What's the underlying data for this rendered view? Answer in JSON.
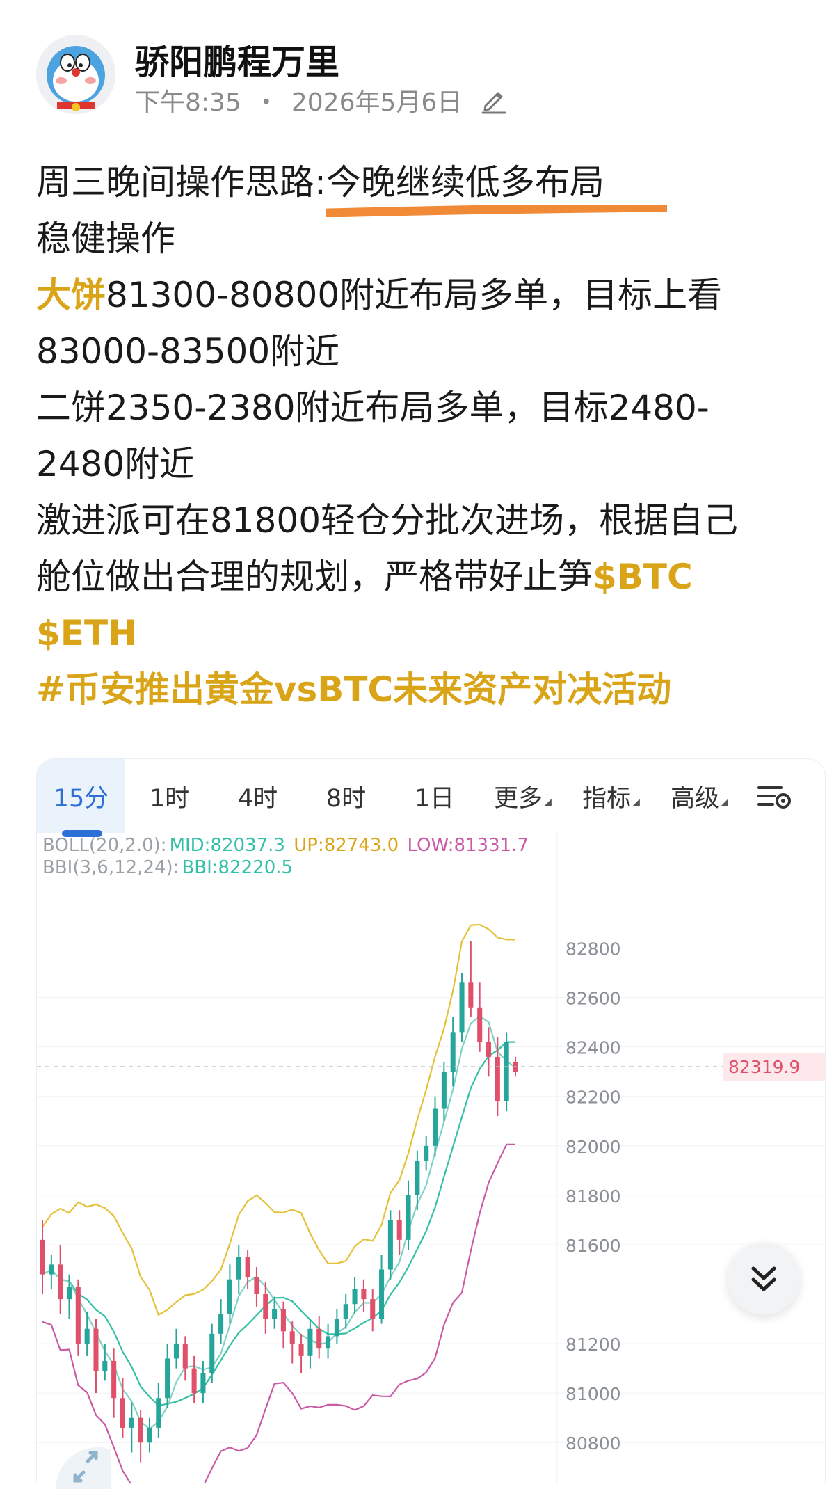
{
  "post": {
    "author": "骄阳鹏程万里",
    "time": "下午8:35",
    "separator": "・",
    "date": "2026年5月6日",
    "line1_prefix": "周三晚间操作思路:",
    "line1_underlined": "今晚继续低多布局",
    "line2": "稳健操作",
    "line3_label": "大饼",
    "line3_rest": "81300-80800附近布局多单，目标上看",
    "line4": "83000-83500附近",
    "line5": "二饼2350-2380附近布局多单，目标2480-",
    "line6": "2480附近",
    "line7": "激进派可在81800轻仓分批次进场，根据自己",
    "line8": "舱位做出合理的规划，严格带好止笋",
    "tag_btc": "$BTC",
    "tag_eth": "$ETH",
    "hashtag": "#币安推出黄金vsBTC未来资产对决活动"
  },
  "kline": {
    "tabs": [
      {
        "label": "15分",
        "active": true
      },
      {
        "label": "1时"
      },
      {
        "label": "4时"
      },
      {
        "label": "8时"
      },
      {
        "label": "1日"
      },
      {
        "label": "更多",
        "caret": true
      },
      {
        "label": "指标",
        "caret": true
      },
      {
        "label": "高级",
        "caret": true
      }
    ],
    "settings_icon": "chart-settings-icon",
    "boll_label": "BOLL(20,2.0):",
    "boll_mid": "MID:82037.3",
    "boll_up": "UP:82743.0",
    "boll_low": "LOW:81331.7",
    "bbi_label": "BBI(3,6,12,24):",
    "bbi_value": "BBI:82220.5",
    "high_marker": "82828.7",
    "last_price": "82319.9",
    "colors": {
      "up": "#26a69a",
      "down": "#e0506a",
      "mid": "#33c0a6",
      "upper": "#e3c23a",
      "lower": "#c95aa5",
      "price": "#e0506a"
    }
  },
  "chart_data": {
    "type": "candlestick",
    "y_axis_labels": [
      "82800",
      "82600",
      "82400",
      "82200",
      "82000",
      "81800",
      "81600",
      "81200",
      "81000",
      "80800"
    ],
    "ylim": [
      80750,
      82900
    ],
    "high": 82828.7,
    "last": 82319.9,
    "candles": [
      [
        81620,
        81480,
        81700,
        81400
      ],
      [
        81480,
        81520,
        81560,
        81420
      ],
      [
        81520,
        81380,
        81600,
        81320
      ],
      [
        81380,
        81430,
        81480,
        81300
      ],
      [
        81430,
        81200,
        81460,
        81150
      ],
      [
        81200,
        81260,
        81330,
        81150
      ],
      [
        81260,
        81090,
        81300,
        81000
      ],
      [
        81090,
        81130,
        81200,
        81050
      ],
      [
        81130,
        80980,
        81180,
        80900
      ],
      [
        80980,
        80860,
        81060,
        80820
      ],
      [
        80860,
        80900,
        80960,
        80760
      ],
      [
        80900,
        80800,
        80930,
        80720
      ],
      [
        80800,
        80860,
        80900,
        80760
      ],
      [
        80860,
        80980,
        81040,
        80820
      ],
      [
        80980,
        81140,
        81200,
        80940
      ],
      [
        81140,
        81200,
        81260,
        81100
      ],
      [
        81200,
        81100,
        81230,
        81050
      ],
      [
        81100,
        81000,
        81150,
        80960
      ],
      [
        81000,
        81080,
        81130,
        80960
      ],
      [
        81080,
        81240,
        81280,
        81040
      ],
      [
        81240,
        81320,
        81380,
        81200
      ],
      [
        81320,
        81460,
        81520,
        81280
      ],
      [
        81460,
        81550,
        81600,
        81400
      ],
      [
        81550,
        81470,
        81580,
        81420
      ],
      [
        81470,
        81400,
        81510,
        81350
      ],
      [
        81400,
        81300,
        81450,
        81240
      ],
      [
        81300,
        81340,
        81390,
        81260
      ],
      [
        81340,
        81250,
        81370,
        81180
      ],
      [
        81250,
        81200,
        81290,
        81120
      ],
      [
        81200,
        81150,
        81240,
        81080
      ],
      [
        81150,
        81260,
        81300,
        81100
      ],
      [
        81260,
        81180,
        81310,
        81140
      ],
      [
        81180,
        81230,
        81280,
        81140
      ],
      [
        81230,
        81300,
        81340,
        81200
      ],
      [
        81300,
        81360,
        81400,
        81260
      ],
      [
        81360,
        81420,
        81470,
        81320
      ],
      [
        81420,
        81380,
        81460,
        81330
      ],
      [
        81380,
        81300,
        81420,
        81250
      ],
      [
        81300,
        81500,
        81560,
        81280
      ],
      [
        81500,
        81700,
        81740,
        81460
      ],
      [
        81700,
        81620,
        81740,
        81560
      ],
      [
        81620,
        81800,
        81860,
        81580
      ],
      [
        81800,
        81940,
        81980,
        81740
      ],
      [
        81940,
        82000,
        82040,
        81900
      ],
      [
        82000,
        82150,
        82200,
        81960
      ],
      [
        82150,
        82300,
        82340,
        82100
      ],
      [
        82300,
        82460,
        82520,
        82240
      ],
      [
        82460,
        82660,
        82700,
        82420
      ],
      [
        82660,
        82560,
        82829,
        82520
      ],
      [
        82560,
        82420,
        82660,
        82380
      ],
      [
        82420,
        82360,
        82480,
        82280
      ],
      [
        82360,
        82180,
        82440,
        82120
      ],
      [
        82180,
        82420,
        82460,
        82140
      ],
      [
        82340,
        82300,
        82360,
        82280
      ]
    ]
  }
}
